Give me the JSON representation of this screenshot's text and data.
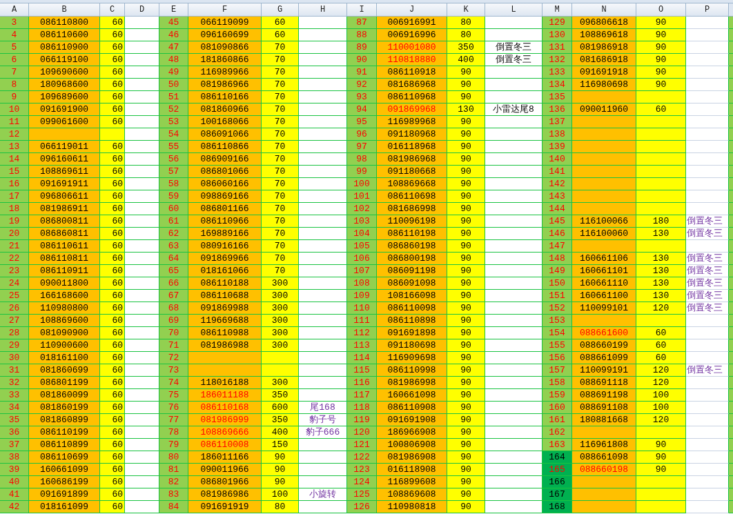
{
  "column_headers": [
    "A",
    "B",
    "C",
    "D",
    "E",
    "F",
    "G",
    "H",
    "I",
    "J",
    "K",
    "L",
    "M",
    "N",
    "O",
    "P"
  ],
  "rows": [
    {
      "cells": [
        {
          "num": "3",
          "num_red": true,
          "selected": false,
          "value": "086110800",
          "value_red": false,
          "price": "60"
        },
        {
          "num": "45",
          "num_red": true,
          "selected": false,
          "value": "066119099",
          "value_red": false,
          "price": "60"
        },
        {
          "num": "87",
          "num_red": true,
          "selected": false,
          "value": "006916991",
          "value_red": false,
          "price": "80"
        },
        {
          "num": "129",
          "num_red": true,
          "selected": false,
          "value": "096806618",
          "value_red": false,
          "price": "90"
        }
      ]
    },
    {
      "cells": [
        {
          "num": "4",
          "num_red": true,
          "selected": false,
          "value": "086110600",
          "value_red": false,
          "price": "60"
        },
        {
          "num": "46",
          "num_red": true,
          "selected": false,
          "value": "096160699",
          "value_red": false,
          "price": "60"
        },
        {
          "num": "88",
          "num_red": true,
          "selected": false,
          "value": "006916996",
          "value_red": false,
          "price": "80"
        },
        {
          "num": "130",
          "num_red": true,
          "selected": false,
          "value": "108869618",
          "value_red": false,
          "price": "90"
        }
      ]
    },
    {
      "cells": [
        {
          "num": "5",
          "num_red": true,
          "selected": false,
          "value": "086110900",
          "value_red": false,
          "price": "60"
        },
        {
          "num": "47",
          "num_red": true,
          "selected": false,
          "value": "081090866",
          "value_red": false,
          "price": "70"
        },
        {
          "num": "89",
          "num_red": true,
          "selected": false,
          "value": "110001080",
          "value_red": true,
          "price": "350",
          "note": {
            "text": "倒置冬三",
            "highlighted": false
          }
        },
        {
          "num": "131",
          "num_red": true,
          "selected": false,
          "value": "081986918",
          "value_red": false,
          "price": "90"
        }
      ]
    },
    {
      "cells": [
        {
          "num": "6",
          "num_red": true,
          "selected": false,
          "value": "066119100",
          "value_red": false,
          "price": "60"
        },
        {
          "num": "48",
          "num_red": true,
          "selected": false,
          "value": "181860866",
          "value_red": false,
          "price": "70"
        },
        {
          "num": "90",
          "num_red": true,
          "selected": false,
          "value": "110818880",
          "value_red": true,
          "price": "400",
          "note": {
            "text": "倒置冬三",
            "highlighted": false
          }
        },
        {
          "num": "132",
          "num_red": true,
          "selected": false,
          "value": "081686918",
          "value_red": false,
          "price": "90"
        }
      ]
    },
    {
      "cells": [
        {
          "num": "7",
          "num_red": true,
          "selected": false,
          "value": "109690600",
          "value_red": false,
          "price": "60"
        },
        {
          "num": "49",
          "num_red": true,
          "selected": false,
          "value": "116989966",
          "value_red": false,
          "price": "70"
        },
        {
          "num": "91",
          "num_red": true,
          "selected": false,
          "value": "086110918",
          "value_red": false,
          "price": "90"
        },
        {
          "num": "133",
          "num_red": true,
          "selected": false,
          "value": "091691918",
          "value_red": false,
          "price": "90"
        }
      ]
    },
    {
      "cells": [
        {
          "num": "8",
          "num_red": true,
          "selected": false,
          "value": "180968600",
          "value_red": false,
          "price": "60"
        },
        {
          "num": "50",
          "num_red": true,
          "selected": false,
          "value": "081986966",
          "value_red": false,
          "price": "70"
        },
        {
          "num": "92",
          "num_red": true,
          "selected": false,
          "value": "081686968",
          "value_red": false,
          "price": "90"
        },
        {
          "num": "134",
          "num_red": true,
          "selected": false,
          "value": "116980698",
          "value_red": false,
          "price": "90"
        }
      ]
    },
    {
      "cells": [
        {
          "num": "9",
          "num_red": true,
          "selected": false,
          "value": "109689600",
          "value_red": false,
          "price": "60"
        },
        {
          "num": "51",
          "num_red": true,
          "selected": false,
          "value": "086110166",
          "value_red": false,
          "price": "70"
        },
        {
          "num": "93",
          "num_red": true,
          "selected": false,
          "value": "086110968",
          "value_red": false,
          "price": "90"
        },
        {
          "num": "135",
          "num_red": true,
          "selected": false,
          "value_red": false
        }
      ]
    },
    {
      "cells": [
        {
          "num": "10",
          "num_red": true,
          "selected": false,
          "value": "091691900",
          "value_red": false,
          "price": "60"
        },
        {
          "num": "52",
          "num_red": true,
          "selected": false,
          "value": "081860966",
          "value_red": false,
          "price": "70"
        },
        {
          "num": "94",
          "num_red": true,
          "selected": false,
          "value": "091869968",
          "value_red": true,
          "price": "130",
          "note": {
            "text": "小雷达尾8",
            "highlighted": false
          }
        },
        {
          "num": "136",
          "num_red": true,
          "selected": false,
          "value": "090011960",
          "value_red": false,
          "price": "60"
        }
      ]
    },
    {
      "cells": [
        {
          "num": "11",
          "num_red": true,
          "selected": false,
          "value": "099061600",
          "value_red": false,
          "price": "60"
        },
        {
          "num": "53",
          "num_red": true,
          "selected": false,
          "value": "100168066",
          "value_red": false,
          "price": "70"
        },
        {
          "num": "95",
          "num_red": true,
          "selected": false,
          "value": "116989968",
          "value_red": false,
          "price": "90"
        },
        {
          "num": "137",
          "num_red": true,
          "selected": false,
          "value_red": false
        }
      ]
    },
    {
      "cells": [
        {
          "num": "12",
          "num_red": true,
          "selected": false,
          "value_red": false
        },
        {
          "num": "54",
          "num_red": true,
          "selected": false,
          "value": "086091066",
          "value_red": false,
          "price": "70"
        },
        {
          "num": "96",
          "num_red": true,
          "selected": false,
          "value": "091180968",
          "value_red": false,
          "price": "90"
        },
        {
          "num": "138",
          "num_red": true,
          "selected": false,
          "value_red": false
        }
      ]
    },
    {
      "cells": [
        {
          "num": "13",
          "num_red": true,
          "selected": false,
          "value": "066119011",
          "value_red": false,
          "price": "60"
        },
        {
          "num": "55",
          "num_red": true,
          "selected": false,
          "value": "086110866",
          "value_red": false,
          "price": "70"
        },
        {
          "num": "97",
          "num_red": true,
          "selected": false,
          "value": "016118968",
          "value_red": false,
          "price": "90"
        },
        {
          "num": "139",
          "num_red": true,
          "selected": false,
          "value_red": false
        }
      ]
    },
    {
      "cells": [
        {
          "num": "14",
          "num_red": true,
          "selected": false,
          "value": "096160611",
          "value_red": false,
          "price": "60"
        },
        {
          "num": "56",
          "num_red": true,
          "selected": false,
          "value": "086909166",
          "value_red": false,
          "price": "70"
        },
        {
          "num": "98",
          "num_red": true,
          "selected": false,
          "value": "081986968",
          "value_red": false,
          "price": "90"
        },
        {
          "num": "140",
          "num_red": true,
          "selected": false,
          "value_red": false
        }
      ]
    },
    {
      "cells": [
        {
          "num": "15",
          "num_red": true,
          "selected": false,
          "value": "108869611",
          "value_red": false,
          "price": "60"
        },
        {
          "num": "57",
          "num_red": true,
          "selected": false,
          "value": "086801066",
          "value_red": false,
          "price": "70"
        },
        {
          "num": "99",
          "num_red": true,
          "selected": false,
          "value": "091180668",
          "value_red": false,
          "price": "90"
        },
        {
          "num": "141",
          "num_red": true,
          "selected": false,
          "value_red": false
        }
      ]
    },
    {
      "cells": [
        {
          "num": "16",
          "num_red": true,
          "selected": false,
          "value": "091691911",
          "value_red": false,
          "price": "60"
        },
        {
          "num": "58",
          "num_red": true,
          "selected": false,
          "value": "086060166",
          "value_red": false,
          "price": "70"
        },
        {
          "num": "100",
          "num_red": true,
          "selected": false,
          "value": "108869668",
          "value_red": false,
          "price": "90"
        },
        {
          "num": "142",
          "num_red": true,
          "selected": false,
          "value_red": false
        }
      ]
    },
    {
      "cells": [
        {
          "num": "17",
          "num_red": true,
          "selected": false,
          "value": "096806611",
          "value_red": false,
          "price": "60"
        },
        {
          "num": "59",
          "num_red": true,
          "selected": false,
          "value": "098869166",
          "value_red": false,
          "price": "70"
        },
        {
          "num": "101",
          "num_red": true,
          "selected": false,
          "value": "086110698",
          "value_red": false,
          "price": "90"
        },
        {
          "num": "143",
          "num_red": true,
          "selected": false,
          "value_red": false
        }
      ]
    },
    {
      "cells": [
        {
          "num": "18",
          "num_red": true,
          "selected": false,
          "value": "081986911",
          "value_red": false,
          "price": "60"
        },
        {
          "num": "60",
          "num_red": true,
          "selected": false,
          "value": "086801166",
          "value_red": false,
          "price": "70"
        },
        {
          "num": "102",
          "num_red": true,
          "selected": false,
          "value": "081686998",
          "value_red": false,
          "price": "90"
        },
        {
          "num": "144",
          "num_red": true,
          "selected": false,
          "value_red": false
        }
      ]
    },
    {
      "cells": [
        {
          "num": "19",
          "num_red": true,
          "selected": false,
          "value": "086800811",
          "value_red": false,
          "price": "60"
        },
        {
          "num": "61",
          "num_red": true,
          "selected": false,
          "value": "086110966",
          "value_red": false,
          "price": "70"
        },
        {
          "num": "103",
          "num_red": true,
          "selected": false,
          "value": "110096198",
          "value_red": false,
          "price": "90"
        },
        {
          "num": "145",
          "num_red": true,
          "selected": false,
          "value": "116100066",
          "value_red": false,
          "price": "180",
          "note": {
            "text": "倒置冬三",
            "color": "#7030a0"
          }
        }
      ]
    },
    {
      "cells": [
        {
          "num": "20",
          "num_red": true,
          "selected": false,
          "value": "086860811",
          "value_red": false,
          "price": "60"
        },
        {
          "num": "62",
          "num_red": true,
          "selected": false,
          "value": "169889166",
          "value_red": false,
          "price": "70"
        },
        {
          "num": "104",
          "num_red": true,
          "selected": false,
          "value": "086110198",
          "value_red": false,
          "price": "90"
        },
        {
          "num": "146",
          "num_red": true,
          "selected": false,
          "value": "116100060",
          "value_red": false,
          "price": "130",
          "note": {
            "text": "倒置冬三",
            "color": "#7030a0"
          }
        }
      ]
    },
    {
      "cells": [
        {
          "num": "21",
          "num_red": true,
          "selected": false,
          "value": "086110611",
          "value_red": false,
          "price": "60"
        },
        {
          "num": "63",
          "num_red": true,
          "selected": false,
          "value": "080916166",
          "value_red": false,
          "price": "70"
        },
        {
          "num": "105",
          "num_red": true,
          "selected": false,
          "value": "086860198",
          "value_red": false,
          "price": "90"
        },
        {
          "num": "147",
          "num_red": true,
          "selected": false,
          "value_red": false
        }
      ]
    },
    {
      "cells": [
        {
          "num": "22",
          "num_red": true,
          "selected": false,
          "value": "086110811",
          "value_red": false,
          "price": "60"
        },
        {
          "num": "64",
          "num_red": true,
          "selected": false,
          "value": "091869966",
          "value_red": false,
          "price": "70"
        },
        {
          "num": "106",
          "num_red": true,
          "selected": false,
          "value": "086800198",
          "value_red": false,
          "price": "90"
        },
        {
          "num": "148",
          "num_red": true,
          "selected": false,
          "value": "160661106",
          "value_red": false,
          "price": "130",
          "note": {
            "text": "倒置冬三",
            "color": "#7030a0"
          }
        }
      ]
    },
    {
      "cells": [
        {
          "num": "23",
          "num_red": true,
          "selected": false,
          "value": "086110911",
          "value_red": false,
          "price": "60"
        },
        {
          "num": "65",
          "num_red": true,
          "selected": false,
          "value": "018161066",
          "value_red": false,
          "price": "70"
        },
        {
          "num": "107",
          "num_red": true,
          "selected": false,
          "value": "086091198",
          "value_red": false,
          "price": "90"
        },
        {
          "num": "149",
          "num_red": true,
          "selected": false,
          "value": "160661101",
          "value_red": false,
          "price": "130",
          "note": {
            "text": "倒置冬三",
            "color": "#7030a0"
          }
        }
      ]
    },
    {
      "cells": [
        {
          "num": "24",
          "num_red": true,
          "selected": false,
          "value": "090011800",
          "value_red": false,
          "price": "60"
        },
        {
          "num": "66",
          "num_red": true,
          "selected": false,
          "value": "086110188",
          "value_red": false,
          "price": "300"
        },
        {
          "num": "108",
          "num_red": true,
          "selected": false,
          "value": "086091098",
          "value_red": false,
          "price": "90"
        },
        {
          "num": "150",
          "num_red": true,
          "selected": false,
          "value": "160661110",
          "value_red": false,
          "price": "130",
          "note": {
            "text": "倒置冬三",
            "color": "#7030a0"
          }
        }
      ]
    },
    {
      "cells": [
        {
          "num": "25",
          "num_red": true,
          "selected": false,
          "value": "166168600",
          "value_red": false,
          "price": "60"
        },
        {
          "num": "67",
          "num_red": true,
          "selected": false,
          "value": "086110688",
          "value_red": false,
          "price": "300"
        },
        {
          "num": "109",
          "num_red": true,
          "selected": false,
          "value": "108166098",
          "value_red": false,
          "price": "90"
        },
        {
          "num": "151",
          "num_red": true,
          "selected": false,
          "value": "160661100",
          "value_red": false,
          "price": "130",
          "note": {
            "text": "倒置冬三",
            "color": "#7030a0"
          }
        }
      ]
    },
    {
      "cells": [
        {
          "num": "26",
          "num_red": true,
          "selected": false,
          "value": "110980800",
          "value_red": false,
          "price": "60"
        },
        {
          "num": "68",
          "num_red": true,
          "selected": false,
          "value": "091869988",
          "value_red": false,
          "price": "300"
        },
        {
          "num": "110",
          "num_red": true,
          "selected": false,
          "value": "086110098",
          "value_red": false,
          "price": "90"
        },
        {
          "num": "152",
          "num_red": true,
          "selected": false,
          "value": "110099101",
          "value_red": false,
          "price": "120",
          "note": {
            "text": "倒置冬三",
            "color": "#7030a0"
          }
        }
      ]
    },
    {
      "cells": [
        {
          "num": "27",
          "num_red": true,
          "selected": false,
          "value": "108869600",
          "value_red": false,
          "price": "60"
        },
        {
          "num": "69",
          "num_red": true,
          "selected": false,
          "value": "119669688",
          "value_red": false,
          "price": "300"
        },
        {
          "num": "111",
          "num_red": true,
          "selected": false,
          "value": "086110898",
          "value_red": false,
          "price": "90"
        },
        {
          "num": "153",
          "num_red": true,
          "selected": false,
          "value_red": false
        }
      ]
    },
    {
      "cells": [
        {
          "num": "28",
          "num_red": true,
          "selected": false,
          "value": "081090900",
          "value_red": false,
          "price": "60"
        },
        {
          "num": "70",
          "num_red": true,
          "selected": false,
          "value": "086110988",
          "value_red": false,
          "price": "300"
        },
        {
          "num": "112",
          "num_red": true,
          "selected": false,
          "value": "091691898",
          "value_red": false,
          "price": "90"
        },
        {
          "num": "154",
          "num_red": true,
          "selected": false,
          "value": "088661600",
          "value_red": true,
          "price": "60"
        }
      ]
    },
    {
      "cells": [
        {
          "num": "29",
          "num_red": true,
          "selected": false,
          "value": "110900600",
          "value_red": false,
          "price": "60"
        },
        {
          "num": "71",
          "num_red": true,
          "selected": false,
          "value": "081986988",
          "value_red": false,
          "price": "300"
        },
        {
          "num": "113",
          "num_red": true,
          "selected": false,
          "value": "091180698",
          "value_red": false,
          "price": "90"
        },
        {
          "num": "155",
          "num_red": true,
          "selected": false,
          "value": "088660199",
          "value_red": false,
          "price": "60"
        }
      ]
    },
    {
      "cells": [
        {
          "num": "30",
          "num_red": true,
          "selected": false,
          "value": "018161100",
          "value_red": false,
          "price": "60"
        },
        {
          "num": "72",
          "num_red": true,
          "selected": false,
          "value_red": false
        },
        {
          "num": "114",
          "num_red": true,
          "selected": false,
          "value": "116909698",
          "value_red": false,
          "price": "90"
        },
        {
          "num": "156",
          "num_red": true,
          "selected": false,
          "value": "088661099",
          "value_red": false,
          "price": "60"
        }
      ]
    },
    {
      "cells": [
        {
          "num": "31",
          "num_red": true,
          "selected": false,
          "value": "081860699",
          "value_red": false,
          "price": "60"
        },
        {
          "num": "73",
          "num_red": true,
          "selected": false,
          "value_red": false
        },
        {
          "num": "115",
          "num_red": true,
          "selected": false,
          "value": "086110998",
          "value_red": false,
          "price": "90"
        },
        {
          "num": "157",
          "num_red": true,
          "selected": false,
          "value": "110099191",
          "value_red": false,
          "price": "120",
          "note": {
            "text": "倒置冬三",
            "color": "#7030a0"
          }
        }
      ]
    },
    {
      "cells": [
        {
          "num": "32",
          "num_red": true,
          "selected": false,
          "value": "086801199",
          "value_red": false,
          "price": "60"
        },
        {
          "num": "74",
          "num_red": true,
          "selected": false,
          "value": "118016188",
          "value_red": false,
          "price": "300"
        },
        {
          "num": "116",
          "num_red": true,
          "selected": false,
          "value": "081986998",
          "value_red": false,
          "price": "90"
        },
        {
          "num": "158",
          "num_red": true,
          "selected": false,
          "value": "088691118",
          "value_red": false,
          "price": "120"
        }
      ]
    },
    {
      "cells": [
        {
          "num": "33",
          "num_red": true,
          "selected": false,
          "value": "081860099",
          "value_red": false,
          "price": "60"
        },
        {
          "num": "75",
          "num_red": true,
          "selected": false,
          "value": "186011188",
          "value_red": true,
          "price": "350"
        },
        {
          "num": "117",
          "num_red": true,
          "selected": false,
          "value": "160661098",
          "value_red": false,
          "price": "90"
        },
        {
          "num": "159",
          "num_red": true,
          "selected": false,
          "value": "088691198",
          "value_red": false,
          "price": "100"
        }
      ]
    },
    {
      "cells": [
        {
          "num": "34",
          "num_red": true,
          "selected": false,
          "value": "081860199",
          "value_red": false,
          "price": "60"
        },
        {
          "num": "76",
          "num_red": true,
          "selected": false,
          "value": "086110168",
          "value_red": true,
          "price": "600",
          "note": {
            "text": "尾168",
            "color": "#7030a0"
          }
        },
        {
          "num": "118",
          "num_red": true,
          "selected": false,
          "value": "086110908",
          "value_red": false,
          "price": "90"
        },
        {
          "num": "160",
          "num_red": true,
          "selected": false,
          "value": "088691108",
          "value_red": false,
          "price": "100"
        }
      ]
    },
    {
      "cells": [
        {
          "num": "35",
          "num_red": true,
          "selected": false,
          "value": "081860899",
          "value_red": false,
          "price": "60"
        },
        {
          "num": "77",
          "num_red": true,
          "selected": false,
          "value": "081986999",
          "value_red": true,
          "price": "350",
          "note": {
            "text": "豹子号",
            "color": "#7030a0"
          }
        },
        {
          "num": "119",
          "num_red": true,
          "selected": false,
          "value": "091691908",
          "value_red": false,
          "price": "90"
        },
        {
          "num": "161",
          "num_red": true,
          "selected": false,
          "value": "180881668",
          "value_red": false,
          "price": "120"
        }
      ]
    },
    {
      "cells": [
        {
          "num": "36",
          "num_red": true,
          "selected": false,
          "value": "086110199",
          "value_red": false,
          "price": "60"
        },
        {
          "num": "78",
          "num_red": true,
          "selected": false,
          "value": "108869666",
          "value_red": true,
          "price": "400",
          "note": {
            "text": "豹子666",
            "color": "#7030a0"
          }
        },
        {
          "num": "120",
          "num_red": true,
          "selected": false,
          "value": "186966908",
          "value_red": false,
          "price": "90"
        },
        {
          "num": "162",
          "num_red": true,
          "selected": false,
          "value_red": false
        }
      ]
    },
    {
      "cells": [
        {
          "num": "37",
          "num_red": true,
          "selected": false,
          "value": "086110899",
          "value_red": false,
          "price": "60"
        },
        {
          "num": "79",
          "num_red": true,
          "selected": false,
          "value": "086110008",
          "value_red": true,
          "price": "150"
        },
        {
          "num": "121",
          "num_red": true,
          "selected": false,
          "value": "100806908",
          "value_red": false,
          "price": "90"
        },
        {
          "num": "163",
          "num_red": true,
          "selected": false,
          "value": "116961808",
          "value_red": false,
          "price": "90"
        }
      ]
    },
    {
      "cells": [
        {
          "num": "38",
          "num_red": true,
          "selected": false,
          "value": "086110699",
          "value_red": false,
          "price": "60"
        },
        {
          "num": "80",
          "num_red": true,
          "selected": false,
          "value": "186011166",
          "value_red": false,
          "price": "90"
        },
        {
          "num": "122",
          "num_red": true,
          "selected": false,
          "value": "081986908",
          "value_red": false,
          "price": "90"
        },
        {
          "num": "164",
          "num_red": false,
          "selected": true,
          "value": "088661098",
          "value_red": false,
          "price": "90"
        }
      ]
    },
    {
      "cells": [
        {
          "num": "39",
          "num_red": true,
          "selected": false,
          "value": "160661099",
          "value_red": false,
          "price": "60"
        },
        {
          "num": "81",
          "num_red": true,
          "selected": false,
          "value": "090011966",
          "value_red": false,
          "price": "90"
        },
        {
          "num": "123",
          "num_red": true,
          "selected": false,
          "value": "016118908",
          "value_red": false,
          "price": "90"
        },
        {
          "num": "165",
          "num_red": true,
          "selected": true,
          "value": "088660198",
          "value_red": true,
          "price": "90"
        }
      ]
    },
    {
      "cells": [
        {
          "num": "40",
          "num_red": true,
          "selected": false,
          "value": "160686199",
          "value_red": false,
          "price": "60"
        },
        {
          "num": "82",
          "num_red": true,
          "selected": false,
          "value": "086801966",
          "value_red": false,
          "price": "90"
        },
        {
          "num": "124",
          "num_red": true,
          "selected": false,
          "value": "116899608",
          "value_red": false,
          "price": "90"
        },
        {
          "num": "166",
          "num_red": false,
          "selected": true,
          "value_red": false
        }
      ]
    },
    {
      "cells": [
        {
          "num": "41",
          "num_red": true,
          "selected": false,
          "value": "091691899",
          "value_red": false,
          "price": "60"
        },
        {
          "num": "83",
          "num_red": true,
          "selected": false,
          "value": "081986986",
          "value_red": false,
          "price": "100",
          "note": {
            "text": "小旋转",
            "color": "#7030a0"
          }
        },
        {
          "num": "125",
          "num_red": true,
          "selected": false,
          "value": "108869608",
          "value_red": false,
          "price": "90"
        },
        {
          "num": "167",
          "num_red": false,
          "selected": true,
          "value_red": false
        }
      ]
    },
    {
      "cells": [
        {
          "num": "42",
          "num_red": true,
          "selected": false,
          "value": "018161099",
          "value_red": false,
          "price": "60"
        },
        {
          "num": "84",
          "num_red": true,
          "selected": false,
          "value": "091691919",
          "value_red": false,
          "price": "80"
        },
        {
          "num": "126",
          "num_red": true,
          "selected": false,
          "value": "110980818",
          "value_red": false,
          "price": "90"
        },
        {
          "num": "168",
          "num_red": false,
          "selected": true,
          "value_red": false
        }
      ]
    }
  ]
}
